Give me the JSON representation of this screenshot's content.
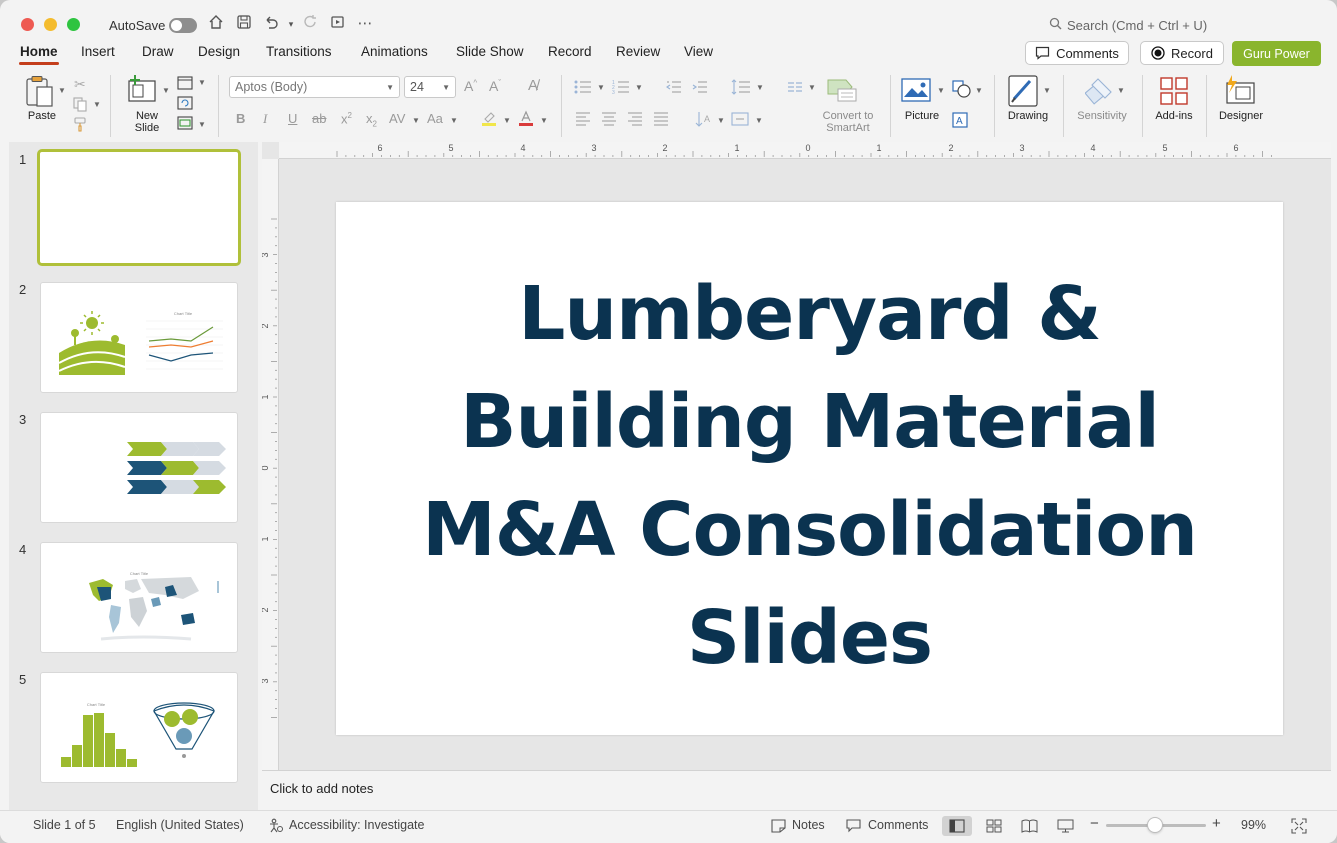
{
  "titlebar": {
    "autosave_label": "AutoSave",
    "search_placeholder": "Search (Cmd + Ctrl + U)"
  },
  "ribbon_tabs": [
    "Home",
    "Insert",
    "Draw",
    "Design",
    "Transitions",
    "Animations",
    "Slide Show",
    "Record",
    "Review",
    "View"
  ],
  "ribbon_tabs_active": "Home",
  "header_buttons": {
    "comments": "Comments",
    "record": "Record",
    "guru": "Guru Power"
  },
  "ribbon": {
    "paste": "Paste",
    "new_slide_line1": "New",
    "new_slide_line2": "Slide",
    "font_name": "Aptos (Body)",
    "font_size": "24",
    "convert_line1": "Convert to",
    "convert_line2": "SmartArt",
    "picture": "Picture",
    "drawing": "Drawing",
    "sensitivity": "Sensitivity",
    "addins": "Add-ins",
    "designer": "Designer"
  },
  "thumbnails": {
    "numbers": [
      "1",
      "2",
      "3",
      "4",
      "5"
    ],
    "chart_title": "Chart Title"
  },
  "slide": {
    "title_lines": [
      "Lumberyard &",
      "Building Material",
      "M&A Consolidation",
      "Slides"
    ]
  },
  "ruler": {
    "h_labels": [
      "6",
      "5",
      "4",
      "3",
      "2",
      "1",
      "0",
      "1",
      "2",
      "3",
      "4",
      "5",
      "6"
    ],
    "v_labels": [
      "3",
      "2",
      "1",
      "0",
      "1",
      "2",
      "3"
    ]
  },
  "notes_placeholder": "Click to add notes",
  "statusbar": {
    "slide_count": "Slide 1 of 5",
    "language": "English (United States)",
    "accessibility": "Accessibility: Investigate",
    "notes": "Notes",
    "comments": "Comments",
    "zoom": "99%"
  },
  "colors": {
    "accent_tab": "#c43e1c",
    "guru": "#8ab52d",
    "title_text": "#0b3350",
    "thumb_green": "#9dbb2f",
    "thumb_navy": "#1d5478"
  }
}
